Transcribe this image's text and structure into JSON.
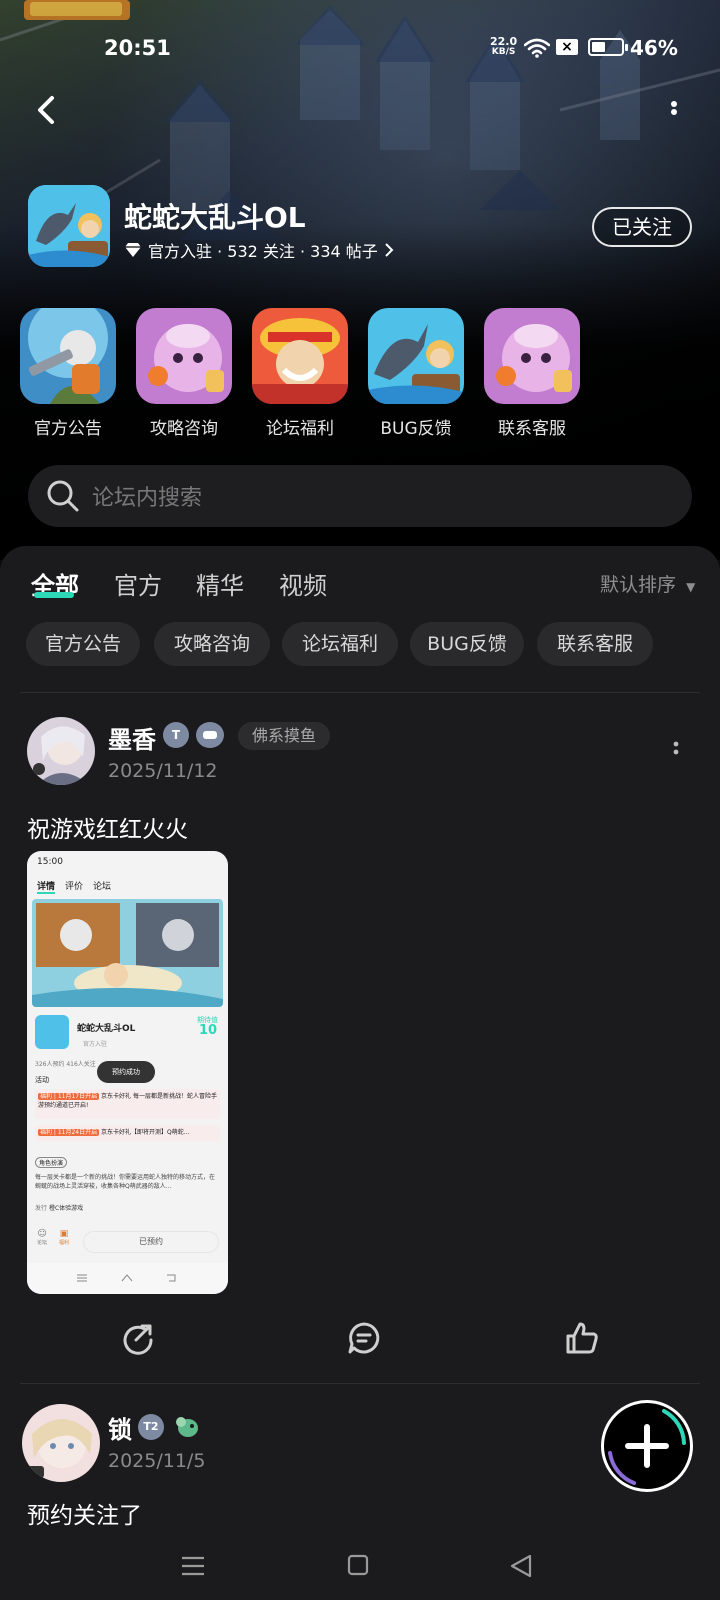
{
  "status_bar": {
    "time": "20:51",
    "net_speed_value": "22.0",
    "net_speed_unit": "KB/S",
    "battery_percent": "46%",
    "battery_level": 0.46
  },
  "forum": {
    "name": "蛇蛇大乱斗OL",
    "meta": "官方入驻 · 532 关注 · 334 帖子",
    "follow_label": "已关注"
  },
  "quick_links": [
    {
      "label": "官方公告"
    },
    {
      "label": "攻略咨询"
    },
    {
      "label": "论坛福利"
    },
    {
      "label": "BUG反馈"
    },
    {
      "label": "联系客服"
    }
  ],
  "search": {
    "placeholder": "论坛内搜索"
  },
  "tabs": [
    {
      "label": "全部",
      "active": true
    },
    {
      "label": "官方"
    },
    {
      "label": "精华"
    },
    {
      "label": "视频"
    }
  ],
  "sort_label": "默认排序",
  "filter_chips": [
    "官方公告",
    "攻略咨询",
    "论坛福利",
    "BUG反馈",
    "联系客服"
  ],
  "posts": [
    {
      "author": "墨香",
      "level_badge": "T",
      "tag": "佛系摸鱼",
      "date": "2025/11/12",
      "text": "祝游戏红红火火",
      "screenshot": {
        "time": "15:00",
        "tabs": [
          "详情",
          "评价",
          "论坛"
        ],
        "game_name": "蛇蛇大乱斗OL",
        "official": "官方入驻",
        "score_label": "期待值",
        "score": "10",
        "stats": "326人预约  416人关注",
        "toast": "预约成功",
        "activity_label": "活动",
        "event1_tag": "福利 | 11月17日开启",
        "event1_text": "京东卡好礼 每一层都是新挑战！蛇人冒险手游预约通道已开启!",
        "event2_tag": "福利 | 11月24日开启",
        "event2_text": "京东卡好礼【即将开测】Q萌蛇…",
        "section_tag": "角色扮演",
        "desc": "每一层关卡都是一个新的挑战！你需要运用蛇人独特的移动方式，在蜿蜒的战场上灵活穿梭，收集各种Q萌武器的敌人…",
        "publisher_label": "发行",
        "publisher": "橙C体验游戏",
        "reserved_label": "已预约",
        "comment_label": "论坛",
        "gift_label": "福利"
      }
    },
    {
      "author": "锁",
      "level_badge": "T2",
      "date": "2025/11/5",
      "text": "预约关注了"
    }
  ],
  "icons": {
    "back": "chevron-left-icon",
    "more": "more-vertical-icon",
    "search": "search-icon",
    "share": "share-icon",
    "comment": "comment-icon",
    "like": "thumbs-up-icon",
    "fab": "plus-icon"
  },
  "colors": {
    "accent": "#2dd8b9",
    "panel": "#1b1b1d",
    "chip": "#2a2a2c"
  }
}
